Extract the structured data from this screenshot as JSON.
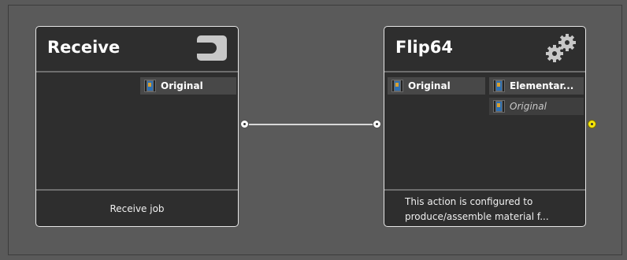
{
  "nodes": {
    "receive": {
      "title": "Receive",
      "icon": "receive-icon",
      "output_chip": "Original",
      "footer": "Receive job"
    },
    "flip": {
      "title": "Flip64",
      "icon": "gears-icon",
      "input_chip": "Original",
      "output_chips": [
        "Elementar...",
        "Original"
      ],
      "footer_line1": "This action is configured to",
      "footer_line2": "produce/assemble material f..."
    }
  },
  "colors": {
    "canvas": "#5a5a5a",
    "node_bg": "#2e2e2e",
    "chip_bg": "#484848",
    "output_port": "#f5e60a"
  }
}
